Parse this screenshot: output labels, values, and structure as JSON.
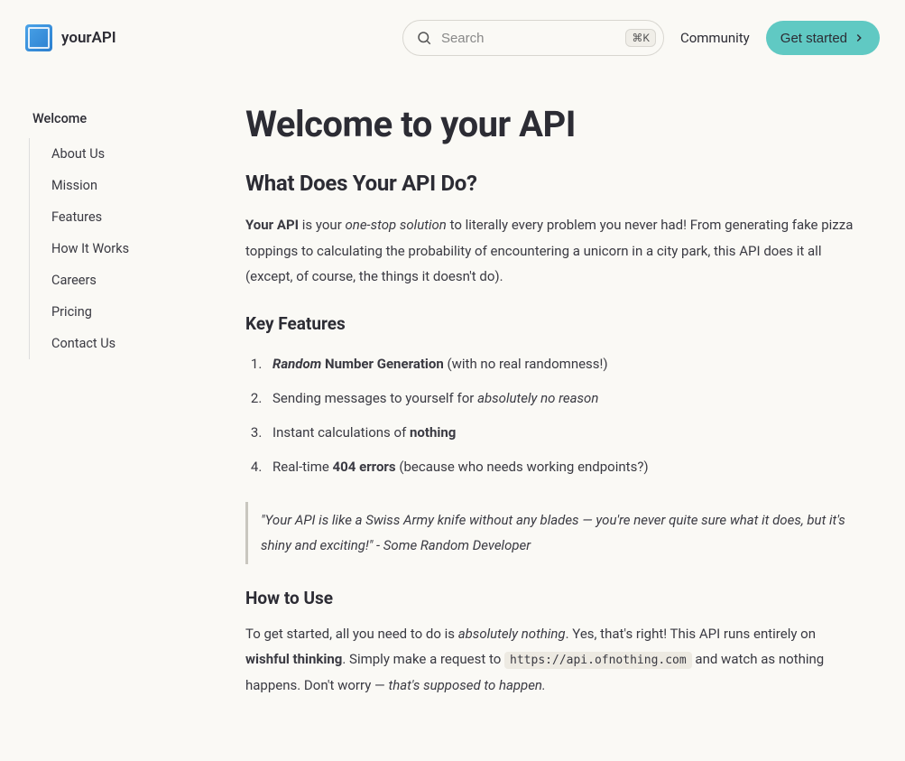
{
  "brand": {
    "name": "yourAPI"
  },
  "header": {
    "search_placeholder": "Search",
    "search_shortcut": "⌘K",
    "community_label": "Community",
    "cta_label": "Get started"
  },
  "sidebar": {
    "root": "Welcome",
    "items": [
      "About Us",
      "Mission",
      "Features",
      "How It Works",
      "Careers",
      "Pricing",
      "Contact Us"
    ]
  },
  "content": {
    "title": "Welcome to your API",
    "section1_heading": "What Does Your API Do?",
    "p1_strong": "Your API",
    "p1_mid1": " is your ",
    "p1_em": "one-stop solution",
    "p1_rest": " to literally every problem you never had! From generating fake pizza toppings to calculating the probability of encountering a unicorn in a city park, this API does it all (except, of course, the things it doesn't do).",
    "keyfeatures_heading": "Key Features",
    "feat1_em": "Random",
    "feat1_strong": " Number Generation",
    "feat1_rest": " (with no real randomness!)",
    "feat2_a": "Sending messages to yourself for ",
    "feat2_em": "absolutely no reason",
    "feat3_a": "Instant calculations of ",
    "feat3_strong": "nothing",
    "feat4_a": "Real-time ",
    "feat4_strong": "404 errors",
    "feat4_rest": " (because who needs working endpoints?)",
    "quote": "\"Your API is like a Swiss Army knife without any blades — you're never quite sure what it does, but it's shiny and exciting!\" - Some Random Developer",
    "howto_heading": "How to Use",
    "p2_a": "To get started, all you need to do is ",
    "p2_em1": "absolutely nothing",
    "p2_b": ". Yes, that's right! This API runs entirely on ",
    "p2_strong": "wishful thinking",
    "p2_c": ". Simply make a request to ",
    "p2_code": "https://api.ofnothing.com",
    "p2_d": " and watch as nothing happens. Don't worry — ",
    "p2_em2": "that's supposed to happen."
  }
}
